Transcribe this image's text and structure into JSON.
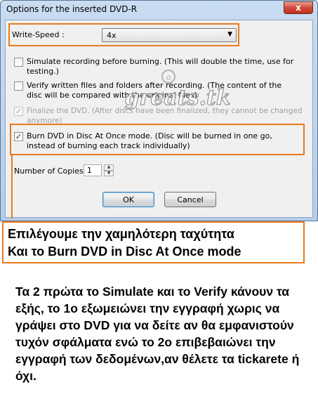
{
  "window": {
    "title": "Options for the inserted DVD-R",
    "close_label": "x"
  },
  "write_speed": {
    "label": "Write-Speed :",
    "value": "4x"
  },
  "options": [
    {
      "label": "Simulate recording before burning. (This will double the time, use for testing.)",
      "checked": false,
      "disabled": false
    },
    {
      "label": "Verify written files and folders after recording. (The content of the disc will be compared with the original files)",
      "checked": false,
      "disabled": false
    },
    {
      "label": "Finalize the DVD. (After discs have been finalized, they cannot be changed anymore)",
      "checked": true,
      "disabled": true
    },
    {
      "label": "Burn DVD in Disc At Once mode. (Disc will be burned in one go, instead of burning each track individually)",
      "checked": true,
      "disabled": false
    }
  ],
  "copies": {
    "label": "Number of Copies :",
    "value": "1"
  },
  "buttons": {
    "ok": "OK",
    "cancel": "Cancel"
  },
  "watermark": "greats.tk",
  "callout": {
    "line1": "Επιλέγουμε την χαμηλότερη ταχύτητα",
    "line2": "Και το Burn DVD in Disc At Once mode"
  },
  "explanation": "Τα 2 πρώτα το Simulate και το Verify κάνουν τα εξής, το 1ο εξωμειώνει την εγγραφή χωρις να γράψει στο DVD για να δείτε αν θα εμφανιστούν τυχόν σφάλματα ενώ το 2ο επιβεβαιώνει την εγγραφή των δεδομένων,αν θέλετε τα tickarete ή όχι.",
  "colors": {
    "highlight": "#e87a1c",
    "titlebar": "#c9dcf1"
  }
}
